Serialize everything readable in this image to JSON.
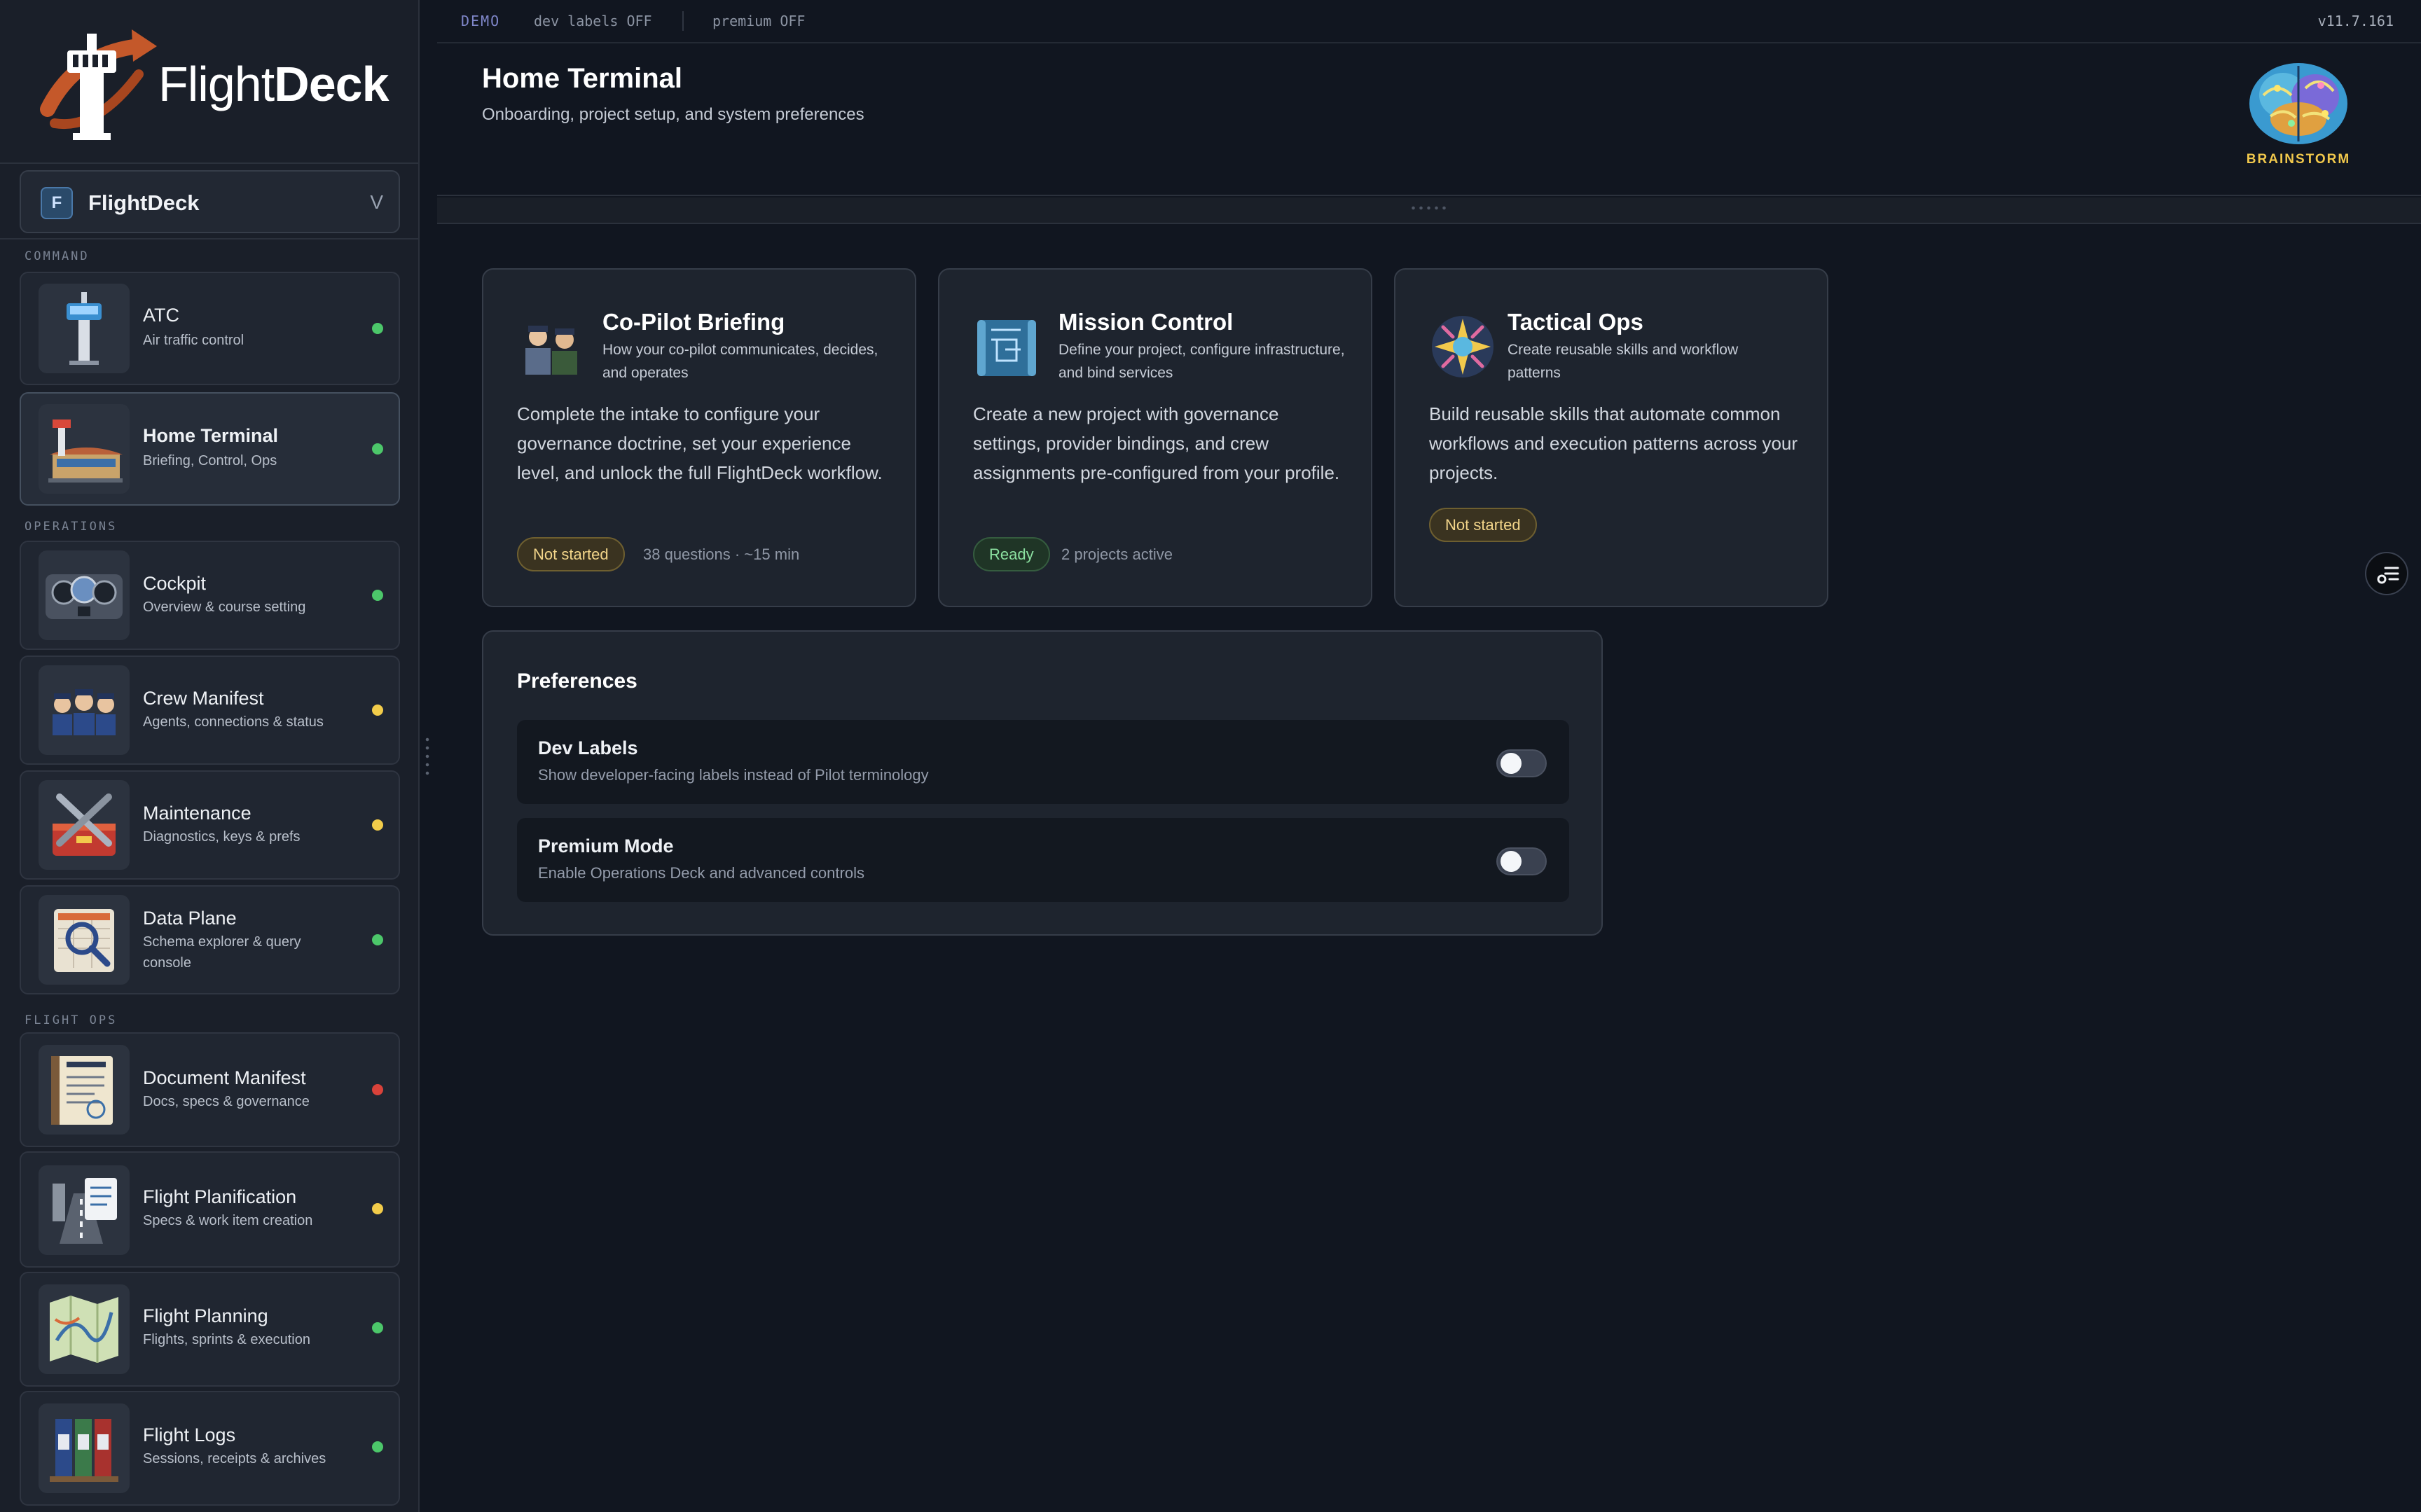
{
  "app": {
    "brand_light": "Flight",
    "brand_bold": "Deck",
    "version": "v11.7.161"
  },
  "topbar": {
    "demo": "DEMO",
    "dev_labels": "dev labels OFF",
    "premium": "premium OFF"
  },
  "project": {
    "avatar": "F",
    "name": "FlightDeck",
    "caret": "V"
  },
  "sidebar": {
    "sections": [
      "COMMAND",
      "OPERATIONS",
      "FLIGHT OPS"
    ],
    "items": [
      {
        "title": "ATC",
        "subtitle": "Air traffic control",
        "status": "green",
        "icon": "control-tower-icon"
      },
      {
        "title": "Home Terminal",
        "subtitle": "Briefing, Control, Ops",
        "status": "green",
        "icon": "terminal-building-icon",
        "active": true
      },
      {
        "title": "Cockpit",
        "subtitle": "Overview & course setting",
        "status": "green",
        "icon": "cockpit-gauges-icon"
      },
      {
        "title": "Crew Manifest",
        "subtitle": "Agents, connections & status",
        "status": "yellow",
        "icon": "pilots-crew-icon"
      },
      {
        "title": "Maintenance",
        "subtitle": "Diagnostics, keys & prefs",
        "status": "yellow",
        "icon": "toolbox-icon"
      },
      {
        "title": "Data Plane",
        "subtitle": "Schema explorer & query console",
        "status": "green",
        "icon": "magnifier-grid-icon"
      },
      {
        "title": "Document Manifest",
        "subtitle": "Docs, specs & governance",
        "status": "red",
        "icon": "manifest-binder-icon"
      },
      {
        "title": "Flight Planification",
        "subtitle": "Specs & work item creation",
        "status": "yellow",
        "icon": "runway-checklist-icon"
      },
      {
        "title": "Flight Planning",
        "subtitle": "Flights, sprints & execution",
        "status": "green",
        "icon": "folded-map-icon"
      },
      {
        "title": "Flight Logs",
        "subtitle": "Sessions, receipts & archives",
        "status": "green",
        "icon": "log-binders-icon"
      }
    ]
  },
  "colors": {
    "green": "#4cc76a",
    "yellow": "#f2cc4a",
    "red": "#d9423a",
    "accent": "#f2c94c"
  },
  "header": {
    "title": "Home Terminal",
    "subtitle": "Onboarding, project setup, and system preferences",
    "brainstorm_label": "BRAINSTORM"
  },
  "cards": [
    {
      "title": "Co-Pilot Briefing",
      "tagline": "How your co-pilot communicates, decides, and operates",
      "description": "Complete the intake to configure your governance doctrine, set your experience level, and unlock the full FlightDeck workflow.",
      "badge": "Not started",
      "meta": "38 questions · ~15 min",
      "icon": "pilots-icon"
    },
    {
      "title": "Mission Control",
      "tagline": "Define your project, configure infrastructure, and bind services",
      "description": "Create a new project with governance settings, provider bindings, and crew assignments pre-configured from your profile.",
      "badge": "Ready",
      "meta": "2 projects active",
      "icon": "blueprint-icon"
    },
    {
      "title": "Tactical Ops",
      "tagline": "Create reusable skills and workflow patterns",
      "description": "Build reusable skills that automate common workflows and execution patterns across your projects.",
      "badge": "Not started",
      "meta": "",
      "icon": "skill-emblem-icon"
    }
  ],
  "preferences": {
    "title": "Preferences",
    "items": [
      {
        "title": "Dev Labels",
        "description": "Show developer-facing labels instead of Pilot terminology",
        "enabled": false
      },
      {
        "title": "Premium Mode",
        "description": "Enable Operations Deck and advanced controls",
        "enabled": false
      }
    ]
  }
}
